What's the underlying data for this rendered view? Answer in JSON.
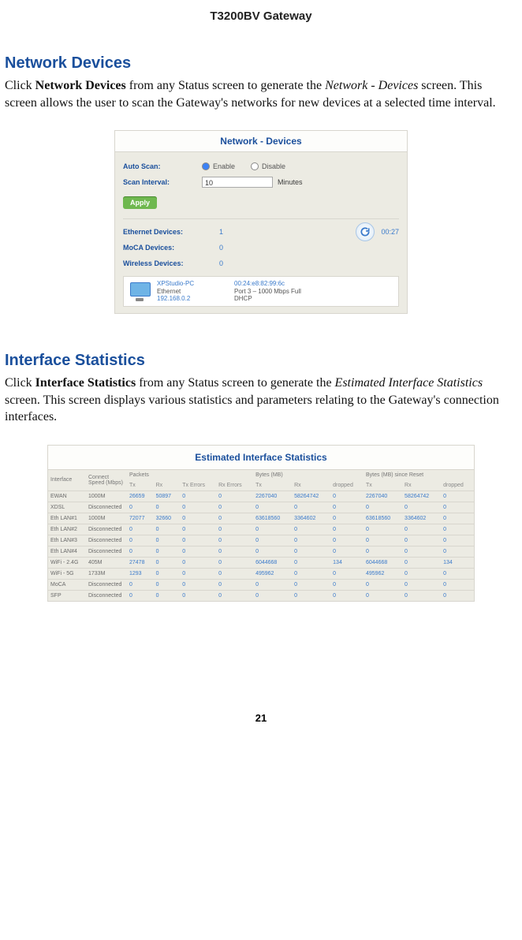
{
  "doc": {
    "title": "T3200BV Gateway",
    "page_number": "21"
  },
  "section1": {
    "heading": "Network Devices",
    "p_pre": "Click ",
    "p_bold": "Network Devices",
    "p_mid": " from any Status screen to generate the ",
    "p_ital": "Network - Devices",
    "p_post": " screen. This screen allows the user to scan the Gateway's networks for new devices at a selected time interval."
  },
  "netdev": {
    "panel_title": "Network - Devices",
    "auto_scan_label": "Auto Scan:",
    "enable_text": "Enable",
    "disable_text": "Disable",
    "auto_scan_value": "Enable",
    "scan_interval_label": "Scan Interval:",
    "scan_interval_value": "10",
    "minutes_text": "Minutes",
    "apply_label": "Apply",
    "eth_label": "Ethernet Devices:",
    "eth_count": "1",
    "moca_label": "MoCA Devices:",
    "moca_count": "0",
    "wifi_label": "Wireless Devices:",
    "wifi_count": "0",
    "timer": "00:27",
    "device": {
      "name": "XPStudio-PC",
      "type": "Ethernet",
      "ip": "192.168.0.2",
      "mac": "00:24:e8:82:99:6c",
      "port": "Port 3 – 1000 Mbps Full",
      "mode": "DHCP"
    }
  },
  "section2": {
    "heading": "Interface Statistics",
    "p_pre": "Click ",
    "p_bold": "Interface Statistics",
    "p_mid": " from any Status screen to generate the ",
    "p_ital": "Estimated Interface Statistics",
    "p_post": " screen. This screen displays various statistics and parameters relating to the Gateway's connection interfaces."
  },
  "stats": {
    "panel_title": "Estimated Interface Statistics",
    "cols": {
      "iface": "Interface",
      "speed": "Connect Speed (Mbps)",
      "pkts": "Packets",
      "bytes": "Bytes (MB)",
      "bytes_reset": "Bytes (MB) since Reset",
      "tx": "Tx",
      "rx": "Rx",
      "txer": "Tx Errors",
      "rxer": "Rx Errors",
      "drop": "dropped"
    },
    "rows": [
      {
        "iface": "EWAN",
        "speed": "1000M",
        "ptx": "26659",
        "prx": "50897",
        "pte": "0",
        "pre": "0",
        "btx": "2267040",
        "brx": "58264742",
        "bdr": "0",
        "rtx": "2267040",
        "rrx": "58264742",
        "rdr": "0"
      },
      {
        "iface": "XDSL",
        "speed": "Disconnected",
        "ptx": "0",
        "prx": "0",
        "pte": "0",
        "pre": "0",
        "btx": "0",
        "brx": "0",
        "bdr": "0",
        "rtx": "0",
        "rrx": "0",
        "rdr": "0"
      },
      {
        "iface": "Eth LAN#1",
        "speed": "1000M",
        "ptx": "72077",
        "prx": "32660",
        "pte": "0",
        "pre": "0",
        "btx": "63618560",
        "brx": "3364602",
        "bdr": "0",
        "rtx": "63618560",
        "rrx": "3364602",
        "rdr": "0"
      },
      {
        "iface": "Eth LAN#2",
        "speed": "Disconnected",
        "ptx": "0",
        "prx": "0",
        "pte": "0",
        "pre": "0",
        "btx": "0",
        "brx": "0",
        "bdr": "0",
        "rtx": "0",
        "rrx": "0",
        "rdr": "0"
      },
      {
        "iface": "Eth LAN#3",
        "speed": "Disconnected",
        "ptx": "0",
        "prx": "0",
        "pte": "0",
        "pre": "0",
        "btx": "0",
        "brx": "0",
        "bdr": "0",
        "rtx": "0",
        "rrx": "0",
        "rdr": "0"
      },
      {
        "iface": "Eth LAN#4",
        "speed": "Disconnected",
        "ptx": "0",
        "prx": "0",
        "pte": "0",
        "pre": "0",
        "btx": "0",
        "brx": "0",
        "bdr": "0",
        "rtx": "0",
        "rrx": "0",
        "rdr": "0"
      },
      {
        "iface": "WiFi - 2.4G",
        "speed": "405M",
        "ptx": "27478",
        "prx": "0",
        "pte": "0",
        "pre": "0",
        "btx": "6044668",
        "brx": "0",
        "bdr": "134",
        "rtx": "6044668",
        "rrx": "0",
        "rdr": "134"
      },
      {
        "iface": "WiFi - 5G",
        "speed": "1733M",
        "ptx": "1293",
        "prx": "0",
        "pte": "0",
        "pre": "0",
        "btx": "495962",
        "brx": "0",
        "bdr": "0",
        "rtx": "495962",
        "rrx": "0",
        "rdr": "0"
      },
      {
        "iface": "MoCA",
        "speed": "Disconnected",
        "ptx": "0",
        "prx": "0",
        "pte": "0",
        "pre": "0",
        "btx": "0",
        "brx": "0",
        "bdr": "0",
        "rtx": "0",
        "rrx": "0",
        "rdr": "0"
      },
      {
        "iface": "SFP",
        "speed": "Disconnected",
        "ptx": "0",
        "prx": "0",
        "pte": "0",
        "pre": "0",
        "btx": "0",
        "brx": "0",
        "bdr": "0",
        "rtx": "0",
        "rrx": "0",
        "rdr": "0"
      }
    ]
  }
}
